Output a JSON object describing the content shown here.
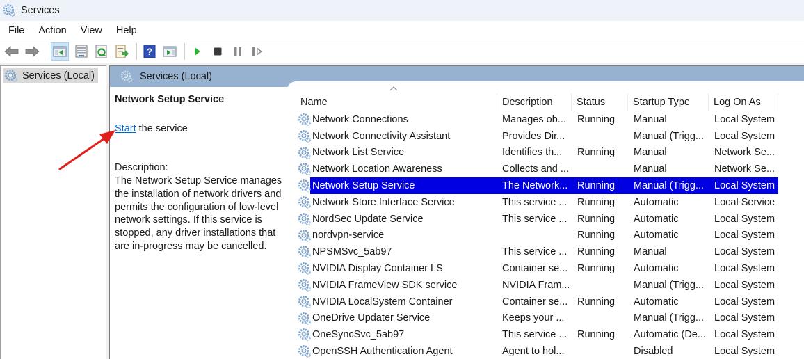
{
  "window": {
    "title": "Services",
    "app_icon": "gear-icon"
  },
  "menu": {
    "items": [
      "File",
      "Action",
      "View",
      "Help"
    ]
  },
  "toolbar": {
    "buttons": [
      {
        "name": "back-button",
        "icon": "arrow-left-icon"
      },
      {
        "name": "forward-button",
        "icon": "arrow-right-icon"
      },
      {
        "name": "show-hide-console-tree-button",
        "icon": "console-tree-icon",
        "active": true
      },
      {
        "name": "properties-button",
        "icon": "properties-icon"
      },
      {
        "name": "refresh-button",
        "icon": "refresh-icon"
      },
      {
        "name": "export-list-button",
        "icon": "export-icon"
      },
      {
        "name": "help-button",
        "icon": "help-icon"
      },
      {
        "name": "show-action-pane-button",
        "icon": "action-pane-icon"
      },
      {
        "name": "start-service-button",
        "icon": "play-icon"
      },
      {
        "name": "stop-service-button",
        "icon": "stop-icon"
      },
      {
        "name": "pause-service-button",
        "icon": "pause-icon"
      },
      {
        "name": "restart-service-button",
        "icon": "restart-icon"
      }
    ]
  },
  "tree": {
    "items": [
      {
        "label": "Services (Local)",
        "selected": true
      }
    ]
  },
  "main": {
    "header_label": "Services (Local)",
    "details": {
      "service_title": "Network Setup Service",
      "start_link": "Start",
      "start_suffix": " the service",
      "description_label": "Description:",
      "description": "The Network Setup Service manages the installation of network drivers and permits the configuration of low-level network settings.  If this service is stopped, any driver installations that are in-progress may be cancelled."
    },
    "columns": [
      "Name",
      "Description",
      "Status",
      "Startup Type",
      "Log On As"
    ],
    "sorted_column": "Name",
    "sort_direction": "ascending",
    "rows": [
      {
        "name": "Network Connections",
        "description": "Manages ob...",
        "status": "Running",
        "startup": "Manual",
        "logon": "Local System"
      },
      {
        "name": "Network Connectivity Assistant",
        "description": "Provides Dir...",
        "status": "",
        "startup": "Manual (Trigg...",
        "logon": "Local System"
      },
      {
        "name": "Network List Service",
        "description": "Identifies th...",
        "status": "Running",
        "startup": "Manual",
        "logon": "Network Se..."
      },
      {
        "name": "Network Location Awareness",
        "description": "Collects and ...",
        "status": "",
        "startup": "Manual",
        "logon": "Network Se..."
      },
      {
        "name": "Network Setup Service",
        "description": "The Network...",
        "status": "Running",
        "startup": "Manual (Trigg...",
        "logon": "Local System",
        "selected": true
      },
      {
        "name": "Network Store Interface Service",
        "description": "This service ...",
        "status": "Running",
        "startup": "Automatic",
        "logon": "Local Service"
      },
      {
        "name": "NordSec Update Service",
        "description": "This service ...",
        "status": "Running",
        "startup": "Automatic",
        "logon": "Local System"
      },
      {
        "name": "nordvpn-service",
        "description": "",
        "status": "Running",
        "startup": "Automatic",
        "logon": "Local System"
      },
      {
        "name": "NPSMSvc_5ab97",
        "description": "This service ...",
        "status": "Running",
        "startup": "Manual",
        "logon": "Local System"
      },
      {
        "name": "NVIDIA Display Container LS",
        "description": "Container se...",
        "status": "Running",
        "startup": "Automatic",
        "logon": "Local System"
      },
      {
        "name": "NVIDIA FrameView SDK service",
        "description": "NVIDIA Fram...",
        "status": "",
        "startup": "Manual (Trigg...",
        "logon": "Local System"
      },
      {
        "name": "NVIDIA LocalSystem Container",
        "description": "Container se...",
        "status": "Running",
        "startup": "Automatic",
        "logon": "Local System"
      },
      {
        "name": "OneDrive Updater Service",
        "description": "Keeps your ...",
        "status": "",
        "startup": "Manual (Trigg...",
        "logon": "Local System"
      },
      {
        "name": "OneSyncSvc_5ab97",
        "description": "This service ...",
        "status": "Running",
        "startup": "Automatic (De...",
        "logon": "Local System"
      },
      {
        "name": "OpenSSH Authentication Agent",
        "description": "Agent to hol...",
        "status": "",
        "startup": "Disabled",
        "logon": "Local System"
      }
    ]
  },
  "annotation": {
    "type": "red-arrow",
    "points_to": "Start link",
    "color": "#e0201b"
  },
  "colors": {
    "selection": "#0000e0",
    "header_band": "#97b2d0",
    "link": "#0066cc",
    "titlebar": "#eef3f9"
  }
}
